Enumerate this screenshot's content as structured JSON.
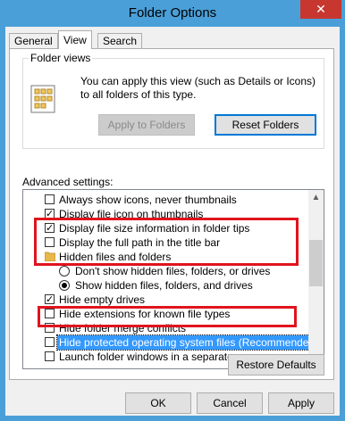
{
  "window": {
    "title": "Folder Options",
    "close_glyph": "✕"
  },
  "tabs": [
    {
      "label": "General",
      "active": false
    },
    {
      "label": "View",
      "active": true
    },
    {
      "label": "Search",
      "active": false
    }
  ],
  "folder_views": {
    "title": "Folder views",
    "icon": "folder-views-icon",
    "description": "You can apply this view (such as Details or Icons) to all folders of this type.",
    "apply_label": "Apply to Folders",
    "reset_label": "Reset Folders"
  },
  "advanced": {
    "label": "Advanced settings:",
    "items": [
      {
        "kind": "checkbox",
        "checked": false,
        "label": "Always show icons, never thumbnails"
      },
      {
        "kind": "checkbox",
        "checked": true,
        "label": "Display file icon on thumbnails"
      },
      {
        "kind": "checkbox",
        "checked": true,
        "label": "Display file size information in folder tips"
      },
      {
        "kind": "checkbox",
        "checked": false,
        "label": "Display the full path in the title bar"
      },
      {
        "kind": "folder",
        "label": "Hidden files and folders"
      },
      {
        "kind": "radio",
        "checked": false,
        "label": "Don't show hidden files, folders, or drives"
      },
      {
        "kind": "radio",
        "checked": true,
        "label": "Show hidden files, folders, and drives"
      },
      {
        "kind": "checkbox",
        "checked": true,
        "label": "Hide empty drives"
      },
      {
        "kind": "checkbox",
        "checked": false,
        "label": "Hide extensions for known file types"
      },
      {
        "kind": "checkbox",
        "checked": false,
        "label": "Hide folder merge conflicts"
      },
      {
        "kind": "checkbox",
        "checked": false,
        "label": "Hide protected operating system files (Recommended)",
        "selected": true
      },
      {
        "kind": "checkbox",
        "checked": false,
        "label": "Launch folder windows in a separate process"
      }
    ],
    "restore_label": "Restore Defaults"
  },
  "footer": {
    "ok_label": "OK",
    "cancel_label": "Cancel",
    "apply_label": "Apply"
  },
  "colors": {
    "title_bar": "#4a9fd8",
    "close_button": "#c7372f",
    "highlight": "#e0141e",
    "selection": "#3399ff"
  }
}
